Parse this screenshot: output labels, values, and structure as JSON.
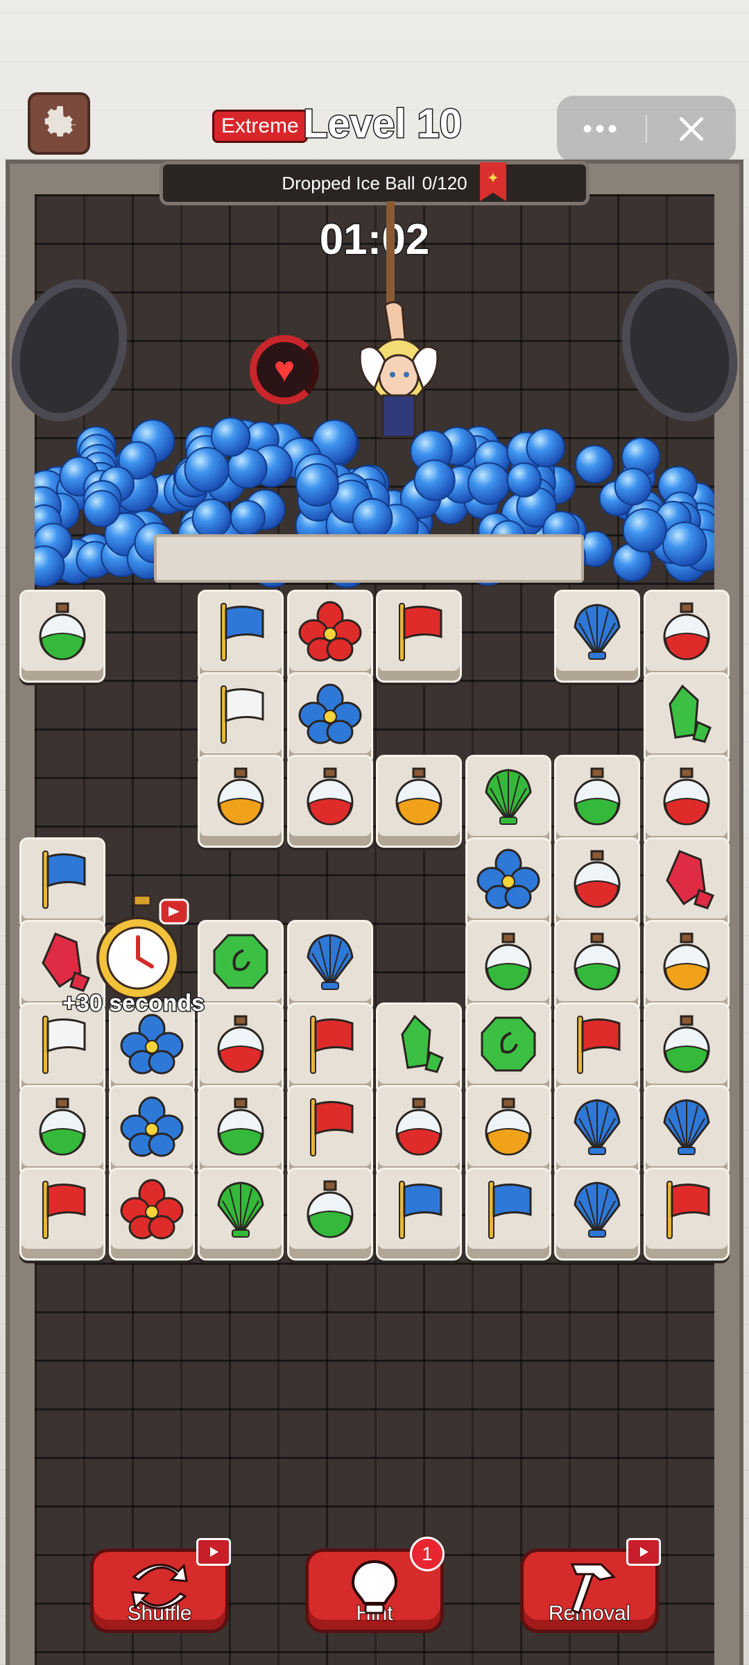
{
  "header": {
    "difficulty": "Extreme",
    "level_title": "Level 10",
    "more_label": "•••",
    "settings_icon": "gear-icon",
    "close_icon": "close-icon"
  },
  "goal": {
    "label": "Dropped Ice Ball",
    "progress_text": "0/120",
    "current": 0,
    "target": 120,
    "badge_icon": "star-bookmark-icon"
  },
  "timer": {
    "text": "01:02"
  },
  "powerup": {
    "label": "+30 seconds",
    "icon": "stopwatch-icon"
  },
  "tiles": [
    {
      "type": "potion-green"
    },
    {
      "type": "flag-blue"
    },
    {
      "type": "flower-red"
    },
    {
      "type": "flag-red"
    },
    {
      "type": "shell-blue"
    },
    {
      "type": "potion-red"
    },
    {
      "type": "flag-white"
    },
    {
      "type": "flower-blue"
    },
    {
      "type": "gem-green"
    },
    {
      "type": "potion-yellow"
    },
    {
      "type": "potion-red"
    },
    {
      "type": "potion-yellow"
    },
    {
      "type": "shell-green"
    },
    {
      "type": "potion-green"
    },
    {
      "type": "potion-red"
    },
    {
      "type": "flag-blue"
    },
    {
      "type": "flower-blue"
    },
    {
      "type": "potion-red"
    },
    {
      "type": "gem-red"
    },
    {
      "type": "gem-red"
    },
    {
      "type": "emerald-green"
    },
    {
      "type": "shell-blue"
    },
    {
      "type": "potion-green"
    },
    {
      "type": "potion-green"
    },
    {
      "type": "potion-yellow"
    },
    {
      "type": "flag-white"
    },
    {
      "type": "flower-blue"
    },
    {
      "type": "potion-red"
    },
    {
      "type": "flag-red"
    },
    {
      "type": "gem-green"
    },
    {
      "type": "emerald-green"
    },
    {
      "type": "flag-red"
    },
    {
      "type": "potion-green"
    },
    {
      "type": "potion-green"
    },
    {
      "type": "flower-blue"
    },
    {
      "type": "potion-green"
    },
    {
      "type": "flag-red"
    },
    {
      "type": "potion-red"
    },
    {
      "type": "potion-yellow"
    },
    {
      "type": "shell-blue"
    },
    {
      "type": "shell-blue"
    },
    {
      "type": "flag-red"
    },
    {
      "type": "flower-red"
    },
    {
      "type": "shell-green"
    },
    {
      "type": "potion-green"
    },
    {
      "type": "flag-blue"
    },
    {
      "type": "flag-blue"
    },
    {
      "type": "shell-blue"
    },
    {
      "type": "flag-red"
    }
  ],
  "buttons": {
    "shuffle": {
      "label": "Shuffle",
      "icon": "shuffle-icon",
      "badge": "video"
    },
    "hint": {
      "label": "Hint",
      "icon": "lightbulb-icon",
      "badge_count": "1"
    },
    "removal": {
      "label": "Removal",
      "icon": "hammer-icon",
      "badge": "video"
    }
  },
  "colors": {
    "accent_red": "#d62b2b",
    "ice_blue": "#2f7de0",
    "tile_bg": "#e6e0d6"
  }
}
